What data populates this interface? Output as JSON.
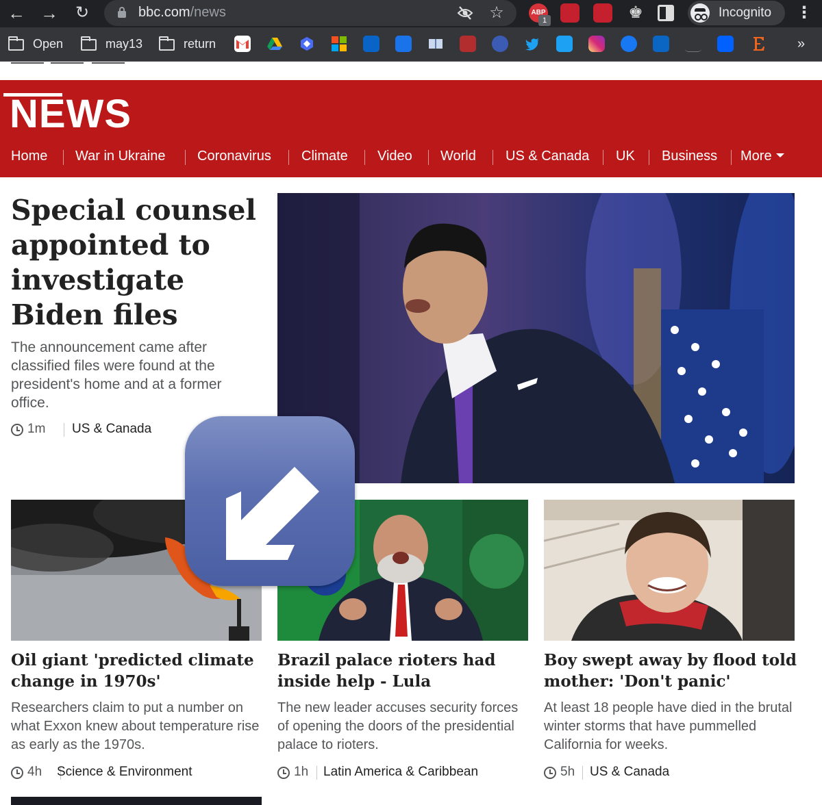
{
  "browser": {
    "url_host": "bbc.com",
    "url_path": "/news",
    "profile_label": "Incognito",
    "extension_badge": "1",
    "extension_abp_label": "ABP"
  },
  "bookmarks": {
    "folders": [
      "Open",
      "may13",
      "return"
    ],
    "more": "»"
  },
  "site": {
    "logo": "NEWS",
    "nav": [
      "Home",
      "War in Ukraine",
      "Coronavirus",
      "Climate",
      "Video",
      "World",
      "US & Canada",
      "UK",
      "Business",
      "More"
    ]
  },
  "hero": {
    "title": "Special counsel appointed to investigate Biden files",
    "summary": "The announcement came after classified files were found at the president's home and at a former office.",
    "time": "1m",
    "section": "US & Canada"
  },
  "cards": [
    {
      "title": "Oil giant 'predicted climate change in 1970s'",
      "summary": "Researchers claim to put a number on what Exxon knew about temperature rise as early as the 1970s.",
      "time": "4h",
      "section": "Science & Environment"
    },
    {
      "title": "Brazil palace rioters had inside help - Lula",
      "summary": "The new leader accuses security forces of opening the doors of the presidential palace to rioters.",
      "time": "1h",
      "section": "Latin America & Caribbean"
    },
    {
      "title": "Boy swept away by flood told mother: 'Don't panic'",
      "summary": "At least 18 people have died in the brutal winter storms that have pummelled California for weeks.",
      "time": "5h",
      "section": "US & Canada"
    }
  ],
  "colors": {
    "bbc_red": "#bb1919",
    "chrome_dark": "#202124",
    "overlay_blue": "#5b6eb0"
  },
  "icons": [
    "back-icon",
    "forward-icon",
    "reload-icon",
    "lock-icon",
    "eye-off-icon",
    "star-icon",
    "puzzle-icon",
    "side-panel-icon",
    "incognito-icon",
    "kebab-menu-icon",
    "folder-icon",
    "clock-icon",
    "arrow-down-left-icon"
  ]
}
